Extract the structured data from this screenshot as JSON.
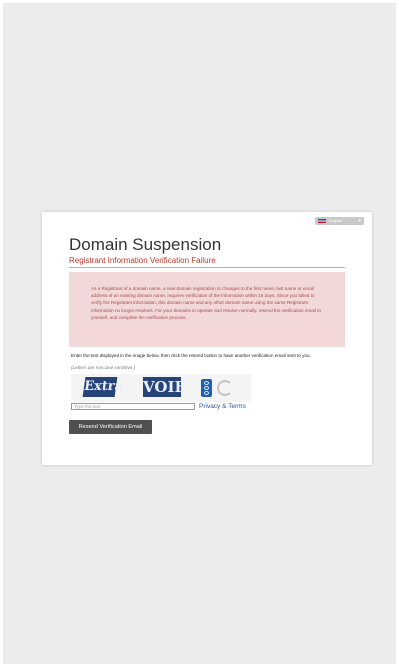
{
  "language": {
    "selected": "English"
  },
  "header": {
    "title": "Domain Suspension",
    "subtitle": "Registrant Information Verification Failure"
  },
  "notice": {
    "text": "As a Registrant of a domain name, a new domain registration or changes to the first name, last name or email address of an existing domain name, requires verification of the information within 15 days. Since you failed to verify the Registrant information, this domain name and any other domain name using the same Registrant information no longer resolves. For your domains to operate and resolve normally, resend the verification email to yourself, and complete the verification process."
  },
  "captcha": {
    "instruction": "Enter the text displayed in the image below, then click the resend button to have another verification email sent to you.",
    "hint": "(Letters are not case sensitive.)",
    "words": [
      "Extra",
      "VOIE"
    ],
    "input_placeholder": "Type the text",
    "privacy_label": "Privacy & Terms"
  },
  "actions": {
    "resend_label": "Resend Verification Email"
  },
  "colors": {
    "accent_red": "#c0392b",
    "notice_bg": "#f2d8d8",
    "button_bg": "#505050",
    "link_blue": "#2a54a8"
  }
}
